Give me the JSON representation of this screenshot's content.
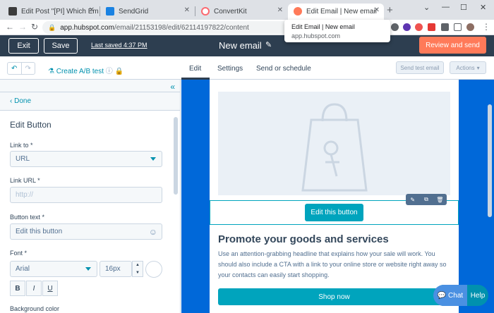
{
  "browser": {
    "tabs": [
      {
        "title": "Edit Post \"[PI] Which Email Ma",
        "favicon_color": "#3c3c3c"
      },
      {
        "title": "SendGrid",
        "favicon_color": "#1a82e2"
      },
      {
        "title": "ConvertKit",
        "favicon_color": "#fb6970"
      },
      {
        "title": "Edit Email | New email",
        "favicon_color": "#ff7a59"
      }
    ],
    "new_tab": "+",
    "url_host": "app.hubspot.com",
    "url_path": "/email/21153198/edit/62114197822/content",
    "tooltip_title": "Edit Email | New email",
    "tooltip_host": "app.hubspot.com"
  },
  "header": {
    "exit_label": "Exit",
    "save_label": "Save",
    "last_saved": "Last saved 4:37 PM",
    "title": "New email",
    "review_label": "Review and send"
  },
  "subheader": {
    "ab_test_label": "Create A/B test",
    "tabs": [
      "Edit",
      "Settings",
      "Send or schedule"
    ],
    "send_test_label": "Send test email",
    "actions_label": "Actions"
  },
  "sidebar": {
    "done_label": "Done",
    "heading": "Edit Button",
    "link_to_label": "Link to *",
    "link_to_value": "URL",
    "link_url_label": "Link URL *",
    "link_url_placeholder": "http://",
    "button_text_label": "Button text *",
    "button_text_value": "Edit this button",
    "font_label": "Font *",
    "font_value": "Arial",
    "font_size": "16px",
    "style_bold": "B",
    "style_italic": "I",
    "style_underline": "U",
    "bg_color_label": "Background color"
  },
  "email": {
    "button_label": "Edit this button",
    "heading": "Promote your goods and services",
    "body": "Use an attention-grabbing headline that explains how your sale will work. You should also include a CTA with a link to your online store or website right away so your contacts can easily start shopping.",
    "shop_label": "Shop now"
  },
  "chat": {
    "chat_label": "Chat",
    "help_label": "Help"
  },
  "colors": {
    "header_bg": "#2d3e50",
    "accent_orange": "#ff7a59",
    "accent_teal": "#00a4bd",
    "canvas_bg": "#0068d9"
  }
}
